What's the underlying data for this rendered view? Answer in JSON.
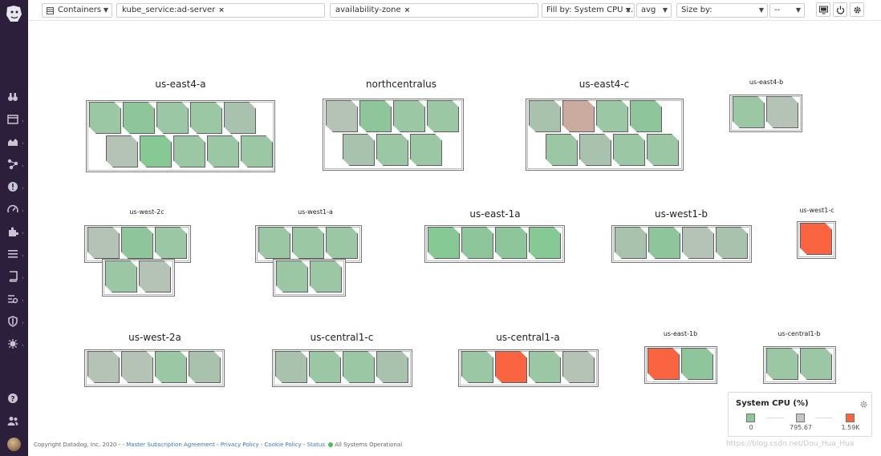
{
  "toolbar": {
    "type_label": "Containers",
    "filter_tags": [
      "kube_service:ad-server"
    ],
    "group_tags": [
      "availability-zone"
    ],
    "fill_label": "Fill by: System CPU ...",
    "fill_agg": "avg",
    "size_label": "Size by:",
    "size_agg": "--",
    "tag_remove": "×"
  },
  "groups": [
    {
      "title": "us-east4-a",
      "size": "lg",
      "colors": [
        "g2",
        "g1",
        "g2",
        "g2",
        "g3",
        "g4",
        "g5",
        "g2",
        "g2",
        "g2"
      ]
    },
    {
      "title": "northcentralus",
      "size": "lg",
      "colors": [
        "g4",
        "g1",
        "g2",
        "g2",
        "g3",
        "g2",
        "g2"
      ]
    },
    {
      "title": "us-east4-c",
      "size": "lg",
      "colors": [
        "g3",
        "pink",
        "g2",
        "g1",
        "g2",
        "g3",
        "g2",
        "g2"
      ]
    },
    {
      "title": "us-east4-b",
      "size": "sm",
      "colors": [
        "g2",
        "g4"
      ]
    },
    {
      "title": "us-west-2c",
      "size": "sm",
      "colors": [
        "g4",
        "g1",
        "g2",
        "g2",
        "g4"
      ]
    },
    {
      "title": "us-west1-a",
      "size": "sm",
      "colors": [
        "g2",
        "g2",
        "g2",
        "g2",
        "g2"
      ]
    },
    {
      "title": "us-east-1a",
      "size": "lg",
      "colors": [
        "g5",
        "g1",
        "g1",
        "g5"
      ]
    },
    {
      "title": "us-west1-b",
      "size": "lg",
      "colors": [
        "g3",
        "g1",
        "g4",
        "g3"
      ]
    },
    {
      "title": "us-west1-c",
      "size": "sm",
      "colors": [
        "red"
      ]
    },
    {
      "title": "us-west-2a",
      "size": "lg",
      "colors": [
        "g4",
        "g4",
        "g2",
        "g3"
      ]
    },
    {
      "title": "us-central1-c",
      "size": "lg",
      "colors": [
        "g3",
        "g2",
        "g2",
        "g3"
      ]
    },
    {
      "title": "us-central1-a",
      "size": "lg",
      "colors": [
        "g2",
        "red",
        "g2",
        "g4"
      ]
    },
    {
      "title": "us-east-1b",
      "size": "sm",
      "colors": [
        "red",
        "g1"
      ]
    },
    {
      "title": "us-central1-b",
      "size": "sm",
      "colors": [
        "g2",
        "g2"
      ]
    }
  ],
  "legend": {
    "title": "System CPU (%)",
    "stops": [
      {
        "label": "0",
        "color": "#8fc59a"
      },
      {
        "label": "795.67",
        "color": "#c4c4c4"
      },
      {
        "label": "1.59K",
        "color": "#fb6440"
      }
    ]
  },
  "footer": {
    "copyright": "Copyright Datadog, Inc. 2020 - -",
    "links": [
      "Master Subscription Agreement",
      "Privacy Policy",
      "Cookie Policy",
      "Status"
    ],
    "status_text": "All Systems Operational"
  },
  "watermark": "https://blog.csdn.net/Dou_Hua_Hua",
  "icons": {
    "sidebar": [
      "binoculars-icon",
      "dashboard-icon",
      "chart-icon",
      "nodes-icon",
      "alert-icon",
      "gauge-icon",
      "puzzle-icon",
      "list-icon",
      "notebook-icon",
      "apm-icon",
      "shield-icon",
      "bug-icon"
    ],
    "sidebar_bottom": [
      "help-icon",
      "team-icon"
    ],
    "toolbar_right": [
      "tv-mode-icon",
      "power-icon",
      "settings-icon"
    ]
  }
}
